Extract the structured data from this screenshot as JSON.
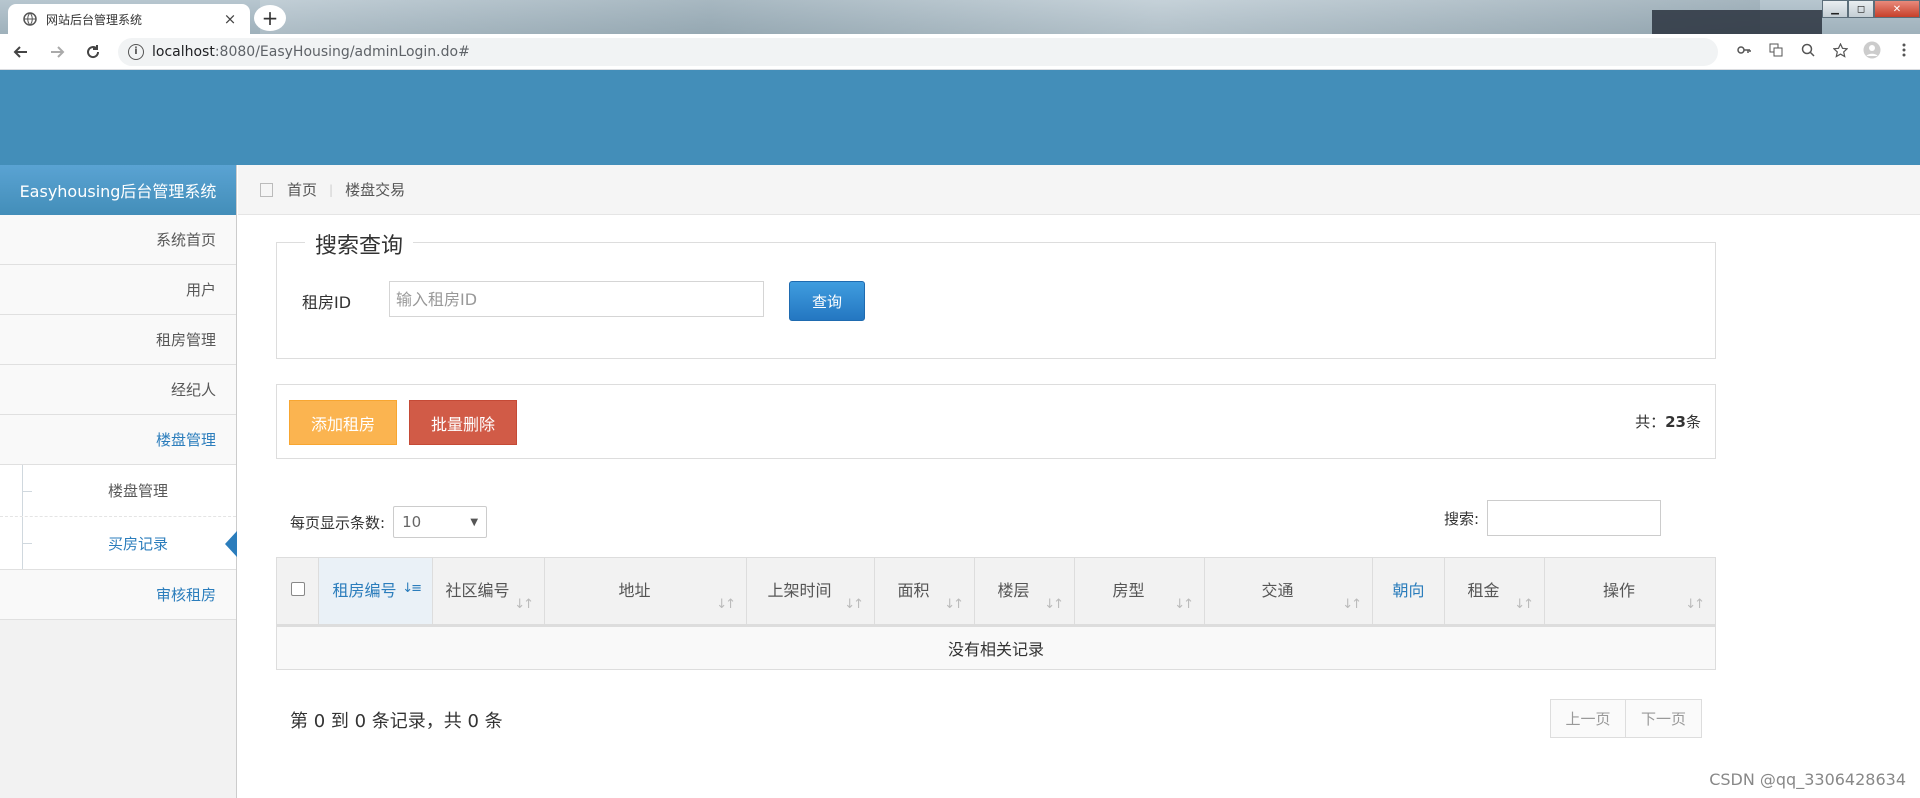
{
  "browser": {
    "tab_title": "网站后台管理系统",
    "tab_close": "×",
    "new_tab": "+",
    "url_host": "localhost",
    "url_rest": ":8080/EasyHousing/adminLogin.do#",
    "win_min": "▁",
    "win_max": "◻",
    "win_close": "✕"
  },
  "sidebar": {
    "brand": "Easyhousing后台管理系统",
    "items": [
      {
        "label": "系统首页"
      },
      {
        "label": "用户"
      },
      {
        "label": "租房管理"
      },
      {
        "label": "经纪人"
      },
      {
        "label": "楼盘管理"
      }
    ],
    "submenu": [
      {
        "label": "楼盘管理"
      },
      {
        "label": "买房记录"
      }
    ],
    "last_item": "审核租房"
  },
  "breadcrumb": {
    "home": "首页",
    "current": "楼盘交易"
  },
  "search": {
    "legend": "搜索查询",
    "label": "租房ID",
    "placeholder": "输入租房ID",
    "button": "查询"
  },
  "toolbar": {
    "add_label": "添加租房",
    "delete_label": "批量删除",
    "total_prefix": "共：",
    "total_count": "23",
    "total_suffix": "条"
  },
  "table_controls": {
    "page_size_label": "每页显示条数:",
    "page_size_value": "10",
    "search_label": "搜索:"
  },
  "table": {
    "columns": [
      "租房编号",
      "社区编号",
      "地址",
      "上架时间",
      "面积",
      "楼层",
      "房型",
      "交通",
      "朝向",
      "租金",
      "操作"
    ],
    "empty_text": "没有相关记录"
  },
  "pagination": {
    "records_text": "第 0 到 0 条记录，共 0 条",
    "prev": "上一页",
    "next": "下一页"
  },
  "watermark": "CSDN @qq_3306428634",
  "colors": {
    "header": "#438eb9",
    "accent": "#2b7dbc",
    "warning": "#fbb450",
    "danger": "#d15b47"
  }
}
